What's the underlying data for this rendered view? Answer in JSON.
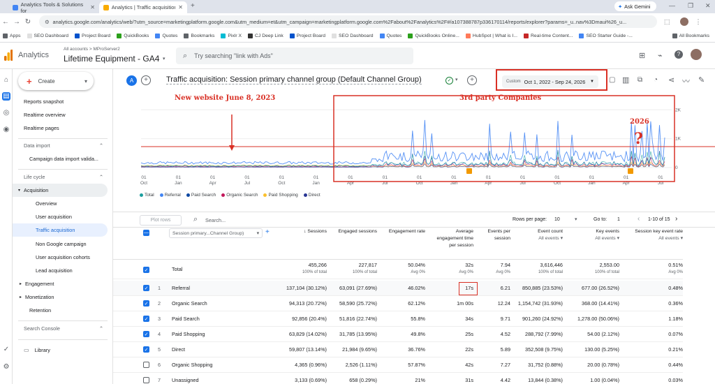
{
  "browser": {
    "tabs": [
      {
        "title": "Analytics Tools & Solutions for"
      },
      {
        "title": "Analytics | Traffic acquisition: Se"
      }
    ],
    "url": "analytics.google.com/analytics/web/?utm_source=marketingplatform.google.com&utm_medium=et&utm_campaign=marketingplatform.google.com%2Fabout%2Fanalytics%2F#/a107388787p336170114/reports/explorer?params=_u..nav%3Dmaui%26_u...",
    "ask_gemini": "Ask Gemini",
    "bookmarks": [
      "Apps",
      "SEO Dashboard",
      "Project Board",
      "QuickBooks",
      "Quotes",
      "Bookmarks",
      "Pixlr X",
      "CJ Deep Link",
      "Project Board",
      "SEO Dashboard",
      "Quotes",
      "QuickBooks Online...",
      "HubSpot | What is I...",
      "Real-time Content...",
      "SEO Starter Guide -..."
    ],
    "all_bookmarks": "All Bookmarks"
  },
  "header": {
    "product": "Analytics",
    "breadcrumb": "All accounts > MProServer2",
    "property": "Lifetime Equipment - GA4",
    "search_placeholder": "Try searching \"link with Ads\""
  },
  "nav": {
    "create": "Create",
    "items": [
      {
        "label": "Reports snapshot",
        "y": 46,
        "x": 16
      },
      {
        "label": "Realtime overview",
        "y": 65,
        "x": 16
      },
      {
        "label": "Realtime pages",
        "y": 84,
        "x": 16
      }
    ],
    "data_import_head": "Data import",
    "data_import_item": "Campaign data import valida...",
    "lifecycle_head": "Life cycle",
    "acquisition": "Acquisition",
    "acq_items": [
      "Overview",
      "User acquisition",
      "Traffic acquisition",
      "Non Google campaign",
      "User acquisition cohorts",
      "Lead acquisition"
    ],
    "engagement": "Engagement",
    "monetization": "Monetization",
    "retention": "Retention",
    "search_console": "Search Console",
    "library": "Library"
  },
  "report": {
    "avatar": "A",
    "title": "Traffic acquisition: Session primary channel group (Default Channel Group)",
    "date_label": "Custom",
    "date_range": "Oct 1, 2022 - Sep 24, 2026"
  },
  "annotations": {
    "new_website": "New website June 8, 2023",
    "third_party": "3rd party Companies",
    "year_2026": "2026",
    "question": "?"
  },
  "chart_data": {
    "type": "line",
    "y_ticks": [
      "2K",
      "1K",
      "0"
    ],
    "ylim": [
      0,
      2200
    ],
    "x_ticks": [
      {
        "d": "01",
        "m": "Oct"
      },
      {
        "d": "01",
        "m": "Jan"
      },
      {
        "d": "01",
        "m": "Apr"
      },
      {
        "d": "01",
        "m": "Jul"
      },
      {
        "d": "01",
        "m": "Oct"
      },
      {
        "d": "01",
        "m": "Jan"
      },
      {
        "d": "01",
        "m": "Apr"
      },
      {
        "d": "01",
        "m": "Jul"
      },
      {
        "d": "01",
        "m": "Oct"
      },
      {
        "d": "01",
        "m": "Jan"
      },
      {
        "d": "01",
        "m": "Apr"
      },
      {
        "d": "01",
        "m": "Jul"
      },
      {
        "d": "01",
        "m": "Oct"
      },
      {
        "d": "01",
        "m": "Jan"
      },
      {
        "d": "01",
        "m": "Apr"
      },
      {
        "d": "01",
        "m": "Jul"
      }
    ],
    "legend": [
      {
        "name": "Total",
        "color": "#1b9e9e"
      },
      {
        "name": "Referral",
        "color": "#4285f4"
      },
      {
        "name": "Paid Search",
        "color": "#0d47a1"
      },
      {
        "name": "Organic Search",
        "color": "#c2185b"
      },
      {
        "name": "Paid Shopping",
        "color": "#fbc02d"
      },
      {
        "name": "Direct",
        "color": "#283593"
      }
    ]
  },
  "table_tools": {
    "plot_rows": "Plot rows",
    "search": "Search...",
    "rows_per_page_label": "Rows per page:",
    "rows_per_page": "10",
    "goto_label": "Go to:",
    "goto": "1",
    "range": "1-10 of 15"
  },
  "table": {
    "dim_header": "Session primary...Channel Group)",
    "columns": [
      {
        "label": "Sessions",
        "sub": ""
      },
      {
        "label": "Engaged sessions",
        "sub": ""
      },
      {
        "label": "Engagement rate",
        "sub": ""
      },
      {
        "label": "Average engagement time per session",
        "sub": ""
      },
      {
        "label": "Events per session",
        "sub": ""
      },
      {
        "label": "Event count",
        "sub": "All events"
      },
      {
        "label": "Key events",
        "sub": "All events"
      },
      {
        "label": "Session key event rate",
        "sub": "All events"
      }
    ],
    "total": {
      "label": "Total",
      "values": [
        "455,266",
        "227,817",
        "50.04%",
        "32s",
        "7.94",
        "3,616,446",
        "2,553.00",
        "0.51%"
      ],
      "subs": [
        "100% of total",
        "100% of total",
        "Avg 0%",
        "Avg 0%",
        "Avg 0%",
        "100% of total",
        "100% of total",
        "Avg 0%"
      ]
    },
    "rows": [
      {
        "n": "1",
        "name": "Referral",
        "checked": true,
        "values": [
          "137,104 (30.12%)",
          "63,091 (27.69%)",
          "46.02%",
          "17s",
          "6.21",
          "850,885 (23.53%)",
          "677.00 (26.52%)",
          "0.48%"
        ]
      },
      {
        "n": "2",
        "name": "Organic Search",
        "checked": true,
        "values": [
          "94,313 (20.72%)",
          "58,590 (25.72%)",
          "62.12%",
          "1m 00s",
          "12.24",
          "1,154,742 (31.93%)",
          "368.00 (14.41%)",
          "0.36%"
        ]
      },
      {
        "n": "3",
        "name": "Paid Search",
        "checked": true,
        "values": [
          "92,856 (20.4%)",
          "51,816 (22.74%)",
          "55.8%",
          "34s",
          "9.71",
          "901,260 (24.92%)",
          "1,278.00 (50.06%)",
          "1.18%"
        ]
      },
      {
        "n": "4",
        "name": "Paid Shopping",
        "checked": true,
        "values": [
          "63,829 (14.02%)",
          "31,785 (13.95%)",
          "49.8%",
          "25s",
          "4.52",
          "288,792 (7.99%)",
          "54.00 (2.12%)",
          "0.07%"
        ]
      },
      {
        "n": "5",
        "name": "Direct",
        "checked": true,
        "values": [
          "59,807 (13.14%)",
          "21,984 (9.65%)",
          "36.76%",
          "22s",
          "5.89",
          "352,508 (9.75%)",
          "130.00 (5.25%)",
          "0.21%"
        ]
      },
      {
        "n": "6",
        "name": "Organic Shopping",
        "checked": false,
        "values": [
          "4,365 (0.96%)",
          "2,526 (1.11%)",
          "57.87%",
          "42s",
          "7.27",
          "31,752 (0.88%)",
          "20.00 (0.78%)",
          "0.44%"
        ]
      },
      {
        "n": "7",
        "name": "Unassigned",
        "checked": false,
        "values": [
          "3,133 (0.69%)",
          "658 (0.29%)",
          "21%",
          "31s",
          "4.42",
          "13,844 (0.38%)",
          "1.00 (0.04%)",
          "0.03%"
        ]
      }
    ]
  }
}
